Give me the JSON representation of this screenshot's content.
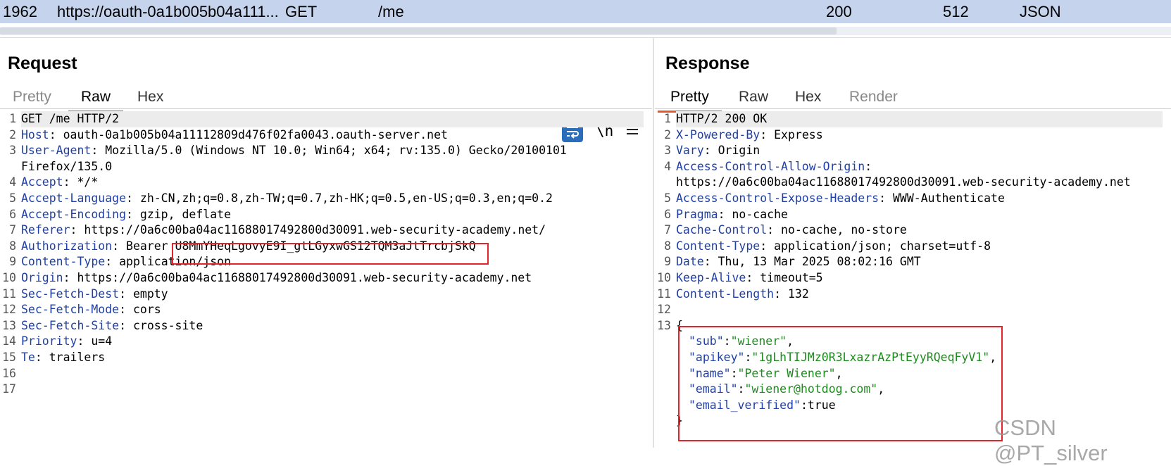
{
  "history": {
    "id": "1962",
    "host": "https://oauth-0a1b005b04a111...",
    "method": "GET",
    "path": "/me",
    "status": "200",
    "length": "512",
    "mime": "JSON"
  },
  "request": {
    "title": "Request",
    "tabs": [
      "Pretty",
      "Raw",
      "Hex"
    ],
    "active_tab": "Raw",
    "tools": {
      "newline_label": "\\n"
    },
    "lines": [
      {
        "n": "1",
        "h": "",
        "v": "GET /me HTTP/2"
      },
      {
        "n": "2",
        "h": "Host",
        "v": ": oauth-0a1b005b04a11112809d476f02fa0043.oauth-server.net"
      },
      {
        "n": "3",
        "h": "User-Agent",
        "v": ": Mozilla/5.0 (Windows NT 10.0; Win64; x64; rv:135.0) Gecko/20100101"
      },
      {
        "n": "",
        "h": "",
        "v": "Firefox/135.0"
      },
      {
        "n": "4",
        "h": "Accept",
        "v": ": */*"
      },
      {
        "n": "5",
        "h": "Accept-Language",
        "v": ": zh-CN,zh;q=0.8,zh-TW;q=0.7,zh-HK;q=0.5,en-US;q=0.3,en;q=0.2"
      },
      {
        "n": "6",
        "h": "Accept-Encoding",
        "v": ": gzip, deflate"
      },
      {
        "n": "7",
        "h": "Referer",
        "v": ": https://0a6c00ba04ac11688017492800d30091.web-security-academy.net/"
      },
      {
        "n": "8",
        "h": "Authorization",
        "v": ": Bearer U8MmYHeqLgovyE9I_gtLGyxwGS12TQM3aJtTrcbjSkQ"
      },
      {
        "n": "9",
        "h": "Content-Type",
        "v": ": application/json"
      },
      {
        "n": "10",
        "h": "Origin",
        "v": ": https://0a6c00ba04ac11688017492800d30091.web-security-academy.net"
      },
      {
        "n": "11",
        "h": "Sec-Fetch-Dest",
        "v": ": empty"
      },
      {
        "n": "12",
        "h": "Sec-Fetch-Mode",
        "v": ": cors"
      },
      {
        "n": "13",
        "h": "Sec-Fetch-Site",
        "v": ": cross-site"
      },
      {
        "n": "14",
        "h": "Priority",
        "v": ": u=4"
      },
      {
        "n": "15",
        "h": "Te",
        "v": ": trailers"
      },
      {
        "n": "16",
        "h": "",
        "v": ""
      },
      {
        "n": "17",
        "h": "",
        "v": ""
      }
    ]
  },
  "response": {
    "title": "Response",
    "tabs": [
      "Pretty",
      "Raw",
      "Hex",
      "Render"
    ],
    "active_tab": "Pretty",
    "lines": [
      {
        "n": "1",
        "h": "",
        "v": "HTTP/2 200 OK"
      },
      {
        "n": "2",
        "h": "X-Powered-By",
        "v": ": Express"
      },
      {
        "n": "3",
        "h": "Vary",
        "v": ": Origin"
      },
      {
        "n": "4",
        "h": "Access-Control-Allow-Origin",
        "v": ":"
      },
      {
        "n": "",
        "h": "",
        "v": "https://0a6c00ba04ac11688017492800d30091.web-security-academy.net"
      },
      {
        "n": "5",
        "h": "Access-Control-Expose-Headers",
        "v": ": WWW-Authenticate"
      },
      {
        "n": "6",
        "h": "Pragma",
        "v": ": no-cache"
      },
      {
        "n": "7",
        "h": "Cache-Control",
        "v": ": no-cache, no-store"
      },
      {
        "n": "8",
        "h": "Content-Type",
        "v": ": application/json; charset=utf-8"
      },
      {
        "n": "9",
        "h": "Date",
        "v": ": Thu, 13 Mar 2025 08:02:16 GMT"
      },
      {
        "n": "10",
        "h": "Keep-Alive",
        "v": ": timeout=5"
      },
      {
        "n": "11",
        "h": "Content-Length",
        "v": ": 132"
      },
      {
        "n": "12",
        "h": "",
        "v": ""
      }
    ],
    "json_start": "13",
    "json_open": "{",
    "json_close": "}",
    "json": [
      {
        "k": "\"sub\"",
        "sep": ":",
        "v": "\"wiener\"",
        "end": ",",
        "str": true
      },
      {
        "k": "\"apikey\"",
        "sep": ":",
        "v": "\"1gLhTIJMz0R3LxazrAzPtEyyRQeqFyV1\"",
        "end": ",",
        "str": true
      },
      {
        "k": "\"name\"",
        "sep": ":",
        "v": "\"Peter Wiener\"",
        "end": ",",
        "str": true
      },
      {
        "k": "\"email\"",
        "sep": ":",
        "v": "\"wiener@hotdog.com\"",
        "end": ",",
        "str": true
      },
      {
        "k": "\"email_verified\"",
        "sep": ":",
        "v": "true",
        "end": "",
        "str": false
      }
    ]
  },
  "colors": {
    "history_row_bg": "#c5d4ec",
    "active_tab_underline": "#e8572c",
    "highlight_box": "#e3242b",
    "header_name": "#1f3fa8",
    "json_string": "#1c8c1c",
    "wrap_button": "#2a6ebb"
  },
  "icons": [
    "word-wrap-icon",
    "newline-toggle-icon",
    "hamburger-menu-icon"
  ],
  "watermark": "CSDN @PT_silver"
}
